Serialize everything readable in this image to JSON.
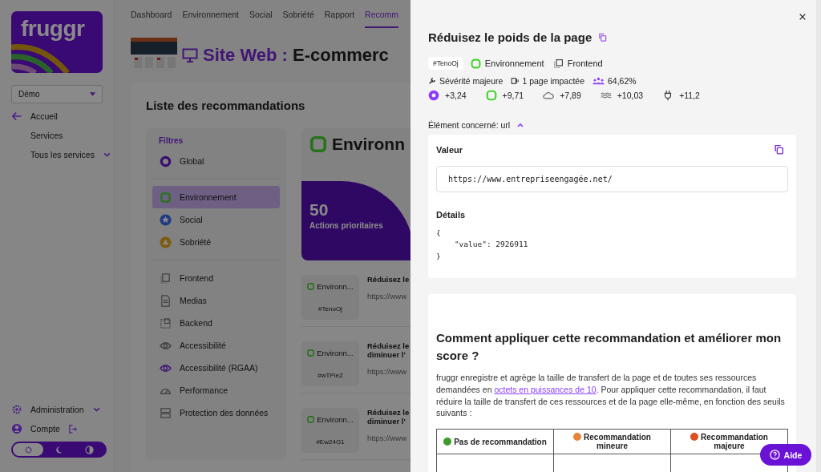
{
  "sidebar": {
    "logo": "fruggr",
    "org_select": {
      "value": "Démo"
    },
    "nav": [
      {
        "label": "Accueil",
        "kind": "back"
      },
      {
        "label": "Services",
        "kind": "plain"
      },
      {
        "label": "Tous les services",
        "kind": "expand"
      }
    ],
    "bottom": [
      {
        "label": "Administration",
        "kind": "admin"
      },
      {
        "label": "Compte",
        "kind": "account"
      }
    ],
    "theme_toggle": [
      {
        "kind": "auto",
        "selected": true
      },
      {
        "kind": "dark",
        "selected": false
      },
      {
        "kind": "contrast",
        "selected": false
      }
    ]
  },
  "tabs": [
    {
      "label": "Dashboard",
      "selected": false
    },
    {
      "label": "Environnement",
      "selected": false
    },
    {
      "label": "Social",
      "selected": false
    },
    {
      "label": "Sobriété",
      "selected": false
    },
    {
      "label": "Rapport",
      "selected": false
    },
    {
      "label": "Recomm",
      "selected": true
    }
  ],
  "header": {
    "type_label": "Site Web :",
    "name": "E-commerc"
  },
  "list_title": "Liste des recommandations",
  "filters": {
    "title": "Filtres",
    "groups": [
      [
        {
          "label": "Global",
          "kind": "global",
          "selected": false
        }
      ],
      [
        {
          "label": "Environnement",
          "kind": "environment",
          "selected": true
        },
        {
          "label": "Social",
          "kind": "social",
          "selected": false
        },
        {
          "label": "Sobriété",
          "kind": "sobriety",
          "selected": false
        }
      ],
      [
        {
          "label": "Frontend",
          "kind": "frontend",
          "selected": false
        },
        {
          "label": "Medias",
          "kind": "medias",
          "selected": false
        },
        {
          "label": "Backend",
          "kind": "backend",
          "selected": false
        },
        {
          "label": "Accessibilité",
          "kind": "eye",
          "selected": false
        },
        {
          "label": "Accessibilité (RGAA)",
          "kind": "eye-accent",
          "selected": false
        },
        {
          "label": "Performance",
          "kind": "gauge",
          "selected": false
        },
        {
          "label": "Protection des données",
          "kind": "server",
          "selected": false
        }
      ]
    ]
  },
  "summary": {
    "heading": "Environn",
    "count": "50",
    "count_label": "Actions prioritaires"
  },
  "items": [
    {
      "category": "Environn...",
      "id": "#TenoOj",
      "title_lines": [
        "Réduisez le"
      ],
      "url": "https://www"
    },
    {
      "category": "Environn...",
      "id": "#wTPleZ",
      "title_lines": [
        "Réduisez le",
        "diminuer l'"
      ],
      "url": "https://www"
    },
    {
      "category": "Environn...",
      "id": "#Ew24G1",
      "title_lines": [
        "Réduisez le",
        "diminuer l'"
      ],
      "url": "https://www"
    }
  ],
  "drawer": {
    "title": "Réduisez le poids de la page",
    "id": "#TenoOj",
    "category": "Environnement",
    "layer": "Frontend",
    "meta": [
      {
        "kind": "severity",
        "text": "Sévérité majeure"
      },
      {
        "kind": "pages",
        "text": "1 page impactée"
      },
      {
        "kind": "users",
        "text": "64,62%"
      }
    ],
    "scores": [
      {
        "kind": "global",
        "text": "+3,24"
      },
      {
        "kind": "environment",
        "text": "+9,71"
      },
      {
        "kind": "cloud",
        "text": "+7,89"
      },
      {
        "kind": "water",
        "text": "+10,03"
      },
      {
        "kind": "energy",
        "text": "+11,2"
      }
    ],
    "element_toggle": {
      "label": "Élément concerné: url",
      "expanded": true
    },
    "value_title": "Valeur",
    "value": "https://www.entrepriseengagée.net/",
    "details_title": "Détails",
    "details_code": "{\n    \"value\": 2926911\n}",
    "howto_title": "Comment appliquer cette recommandation et améliorer mon score ?",
    "howto_before": "fruggr enregistre et agrège la taille de transfert de la page et de toutes ses ressources demandées en ",
    "howto_link": "octets en puissances de 10",
    "howto_after": ". Pour appliquer cette recommandation, il faut réduire la taille de transfert de ces ressources et de la page elle-même, en fonction des seuils suivants :",
    "table_columns": [
      {
        "label": "Pas de recommandation",
        "color": "#3a9a2a"
      },
      {
        "label": "Recommandation mineure",
        "color": "#e8833a"
      },
      {
        "label": "Recommandation majeure",
        "color": "#e0501e"
      }
    ]
  },
  "help_button": "Aide"
}
